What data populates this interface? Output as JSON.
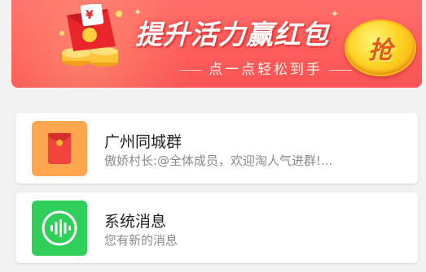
{
  "banner": {
    "title": "提升活力赢红包",
    "subtitle": "点一点轻松到手",
    "grab_label": "抢",
    "envelope_symbol": "¥",
    "colors": {
      "background": "#ff5c5b",
      "button": "#ffd626",
      "button_text": "#e25c10"
    }
  },
  "chats": [
    {
      "name": "广州同城群",
      "last_message": "傲娇村长:@全体成员，欢迎淘人气进群!...",
      "icon": "red-envelope-icon",
      "icon_bg": "#ffa64f"
    },
    {
      "name": "系统消息",
      "last_message": "您有新的消息",
      "icon": "voice-wave-icon",
      "icon_bg": "#2fcf5a"
    }
  ]
}
